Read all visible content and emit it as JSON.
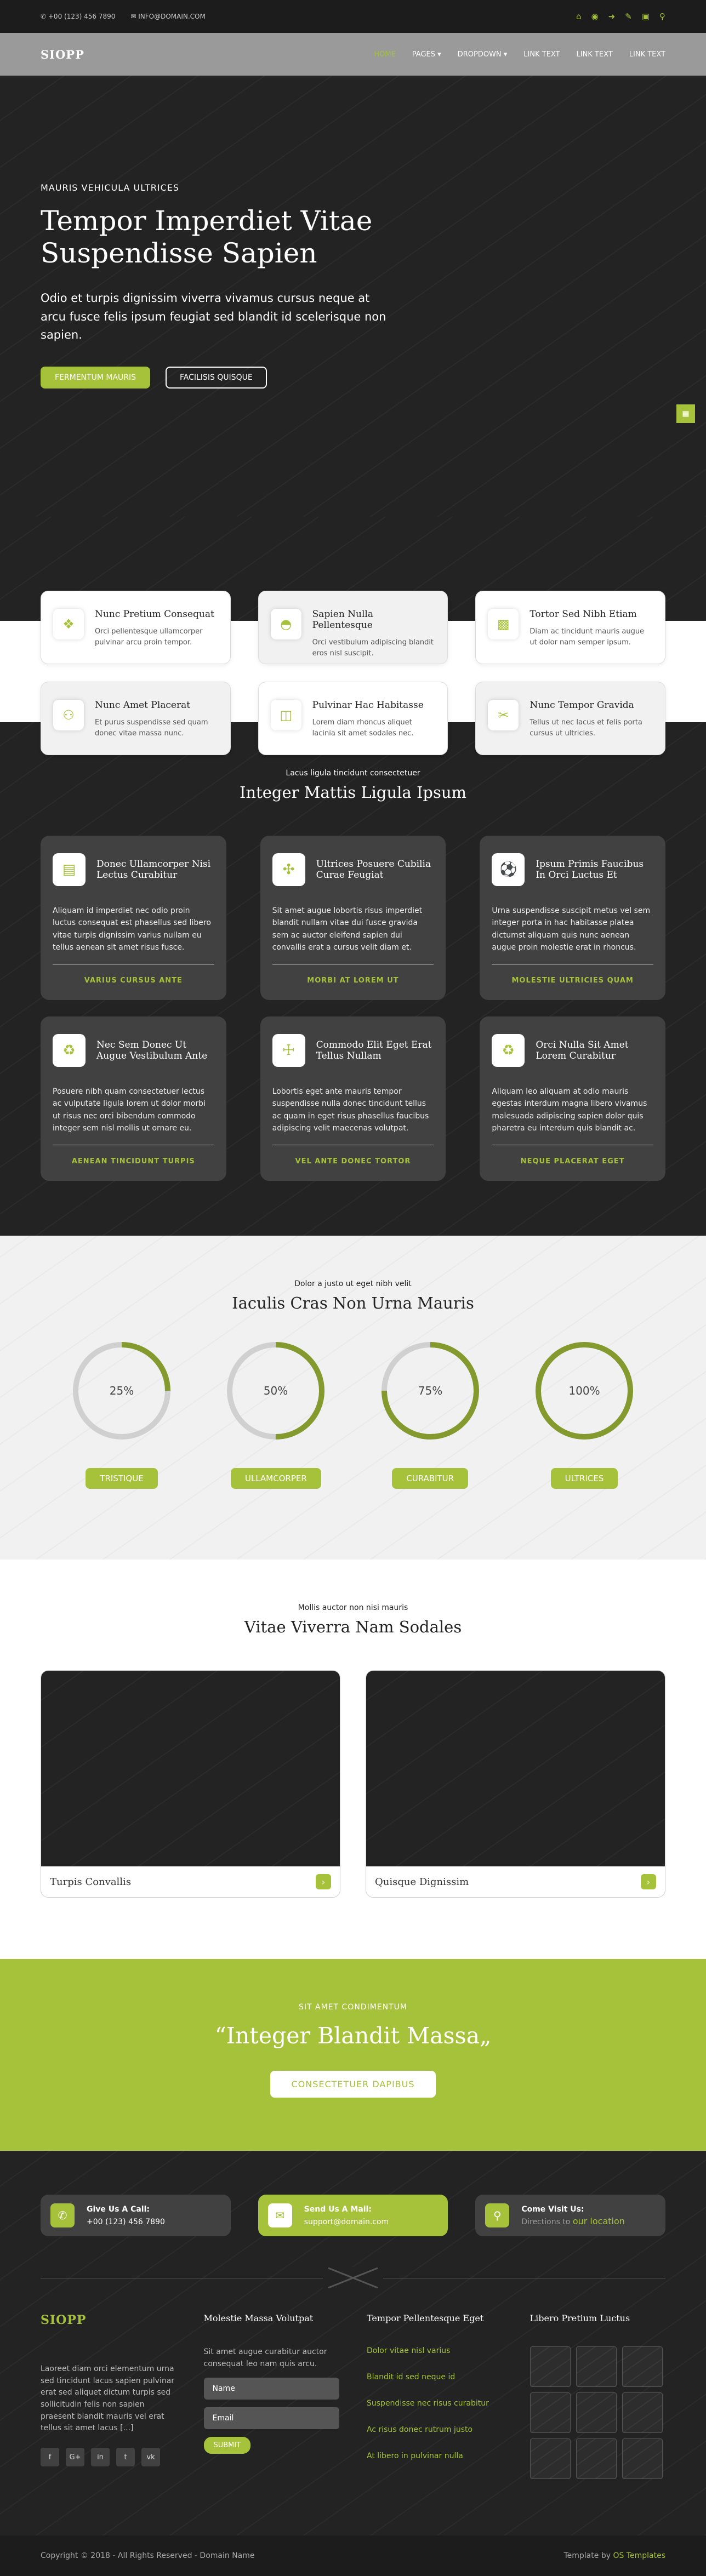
{
  "topbar": {
    "phone": "+00 (123) 456 7890",
    "email": "INFO@DOMAIN.COM",
    "icons": [
      "home-icon",
      "globe-icon",
      "login-icon",
      "send-icon",
      "edit-icon",
      "search-icon"
    ]
  },
  "nav": {
    "logo": "SIOPP",
    "items": [
      "HOME",
      "PAGES",
      "DROPDOWN",
      "LINK TEXT",
      "LINK TEXT",
      "LINK TEXT"
    ]
  },
  "hero": {
    "eyebrow": "MAURIS VEHICULA ULTRICES",
    "title": "Tempor Imperdiet Vitae Suspendisse Sapien",
    "text": "Odio et turpis dignissim viverra vivamus cursus neque at arcu fusce felis ipsum feugiat sed blandit id scelerisque non sapien.",
    "btn_primary": "FERMENTUM MAURIS",
    "btn_secondary": "FACILISIS QUISQUE",
    "side_icon": "grid-icon"
  },
  "features": [
    {
      "title": "Nunc Pretium Consequat",
      "text": "Orci pellentesque ullamcorper pulvinar arcu proin tempor.",
      "icon": "cubes-icon"
    },
    {
      "title": "Sapien Nulla Pellentesque",
      "text": "Orci vestibulum adipiscing blandit eros nisl suscipit.",
      "icon": "basketball-icon"
    },
    {
      "title": "Tortor Sed Nibh Etiam",
      "text": "Diam ac tincidunt mauris augue ut dolor nam semper ipsum.",
      "icon": "building-icon"
    },
    {
      "title": "Nunc Amet Placerat",
      "text": "Et purus suspendisse sed quam donec vitae massa nunc.",
      "icon": "person-walking-icon"
    },
    {
      "title": "Pulvinar Hac Habitasse",
      "text": "Lorem diam rhoncus aliquet lacinia sit amet sodales nec.",
      "icon": "bus-icon"
    },
    {
      "title": "Nunc Tempor Gravida",
      "text": "Tellus ut nec lacus et felis porta cursus ut ultricies.",
      "icon": "scissors-icon"
    }
  ],
  "services": {
    "subtitle": "Lacus ligula tincidunt consectetuer",
    "title": "Integer Mattis Ligula Ipsum",
    "items": [
      {
        "title": "Donec Ullamcorper Nisi Lectus Curabitur",
        "text": "Aliquam id imperdiet nec odio proin luctus consequat est phasellus sed libero vitae turpis dignissim varius nullam eu tellus aenean sit amet risus fusce.",
        "link": "VARIUS CURSUS ANTE",
        "icon": "credit-card-icon"
      },
      {
        "title": "Ultrices Posuere Cubilia Curae Feugiat",
        "text": "Sit amet augue lobortis risus imperdiet blandit nullam vitae dui fusce gravida sem ac auctor eleifend sapien dui convallis erat a cursus velit diam et.",
        "link": "MORBI AT LOREM UT",
        "icon": "crosshair-icon"
      },
      {
        "title": "Ipsum Primis Faucibus In Orci Luctus Et",
        "text": "Urna suspendisse suscipit metus vel sem integer porta in hac habitasse platea dictumst aliquam quis nunc aenean augue proin molestie erat in rhoncus.",
        "link": "MOLESTIE ULTRICIES QUAM",
        "icon": "soccer-ball-icon"
      },
      {
        "title": "Nec Sem Donec Ut Augue Vestibulum Ante",
        "text": "Posuere nibh quam consectetuer lectus ac vulputate ligula lorem ut dolor morbi ut risus nec orci bibendum commodo integer sem nisl mollis ut ornare eu.",
        "link": "AENEAN TINCIDUNT TURPIS",
        "icon": "fire-extinguisher-icon"
      },
      {
        "title": "Commodo Elit Eget Erat Tellus Nullam",
        "text": "Lobortis eget ante mauris tempor suspendisse nulla donec tincidunt tellus ac quam in eget risus phasellus faucibus adipiscing velit maecenas volutpat.",
        "link": "VEL ANTE DONEC TORTOR",
        "icon": "briefcase-medical-icon"
      },
      {
        "title": "Orci Nulla Sit Amet Lorem Curabitur",
        "text": "Aliquam leo aliquam at odio mauris egestas interdum magna libero vivamus malesuada adipiscing sapien dolor quis pharetra eu interdum quis blandit ac.",
        "link": "NEQUE PLACERAT EGET",
        "icon": "recycle-icon"
      }
    ]
  },
  "stats": {
    "subtitle": "Dolor a justo ut eget nibh velit",
    "title": "Iaculis Cras Non Urna Mauris",
    "items": [
      {
        "label": "25%",
        "value": 25,
        "button": "TRISTIQUE"
      },
      {
        "label": "50%",
        "value": 50,
        "button": "ULLAMCORPER"
      },
      {
        "label": "75%",
        "value": 75,
        "button": "CURABITUR"
      },
      {
        "label": "100%",
        "value": 100,
        "button": "ULTRICES"
      }
    ]
  },
  "projects": {
    "subtitle": "Mollis auctor non nisi mauris",
    "title": "Vitae Viverra Nam Sodales",
    "items": [
      {
        "caption": "Turpis Convallis"
      },
      {
        "caption": "Quisque Dignissim"
      }
    ]
  },
  "quote": {
    "small": "SIT AMET CONDIMENTUM",
    "open": "“",
    "text": "Integer Blandit Massa",
    "close": "„",
    "button": "CONSECTETUER DAPIBUS"
  },
  "contact": [
    {
      "title": "Give Us A Call:",
      "value": "+00 (123) 456 7890",
      "icon": "phone-icon"
    },
    {
      "title": "Send Us A Mail:",
      "value": "support@domain.com",
      "icon": "mail-icon"
    },
    {
      "title": "Come Visit Us:",
      "value_prefix": "Directions to ",
      "value_link": "our location",
      "icon": "map-pin-icon"
    }
  ],
  "footer": {
    "logo": "SIOPP",
    "about": "Laoreet diam orci elementum urna sed tincidunt lacus sapien pulvinar erat sed aliquet dictum turpis sed sollicitudin felis non sapien praesent blandit mauris vel erat tellus sit amet lacus [...]",
    "social": [
      "f",
      "G+",
      "in",
      "t",
      "vk"
    ],
    "col2_title": "Molestie Massa Volutpat",
    "col2_text": "Sit amet augue curabitur auctor consequat leo nam quis arcu.",
    "name_placeholder": "Name",
    "email_placeholder": "Email",
    "submit": "SUBMIT",
    "col3_title": "Tempor Pellentesque Eget",
    "links": [
      "Dolor vitae nisl varius",
      "Blandit id sed neque id",
      "Suspendisse nec risus curabitur",
      "Ac risus donec rutrum justo",
      "At libero in pulvinar nulla"
    ],
    "col4_title": "Libero Pretium Luctus"
  },
  "copyright": {
    "text": "Copyright © 2018 - All Rights Reserved - Domain Name",
    "template_prefix": "Template by ",
    "template_link": "OS Templates"
  },
  "colors": {
    "accent": "#a6c13a",
    "dark": "#232323",
    "card": "#414141"
  }
}
